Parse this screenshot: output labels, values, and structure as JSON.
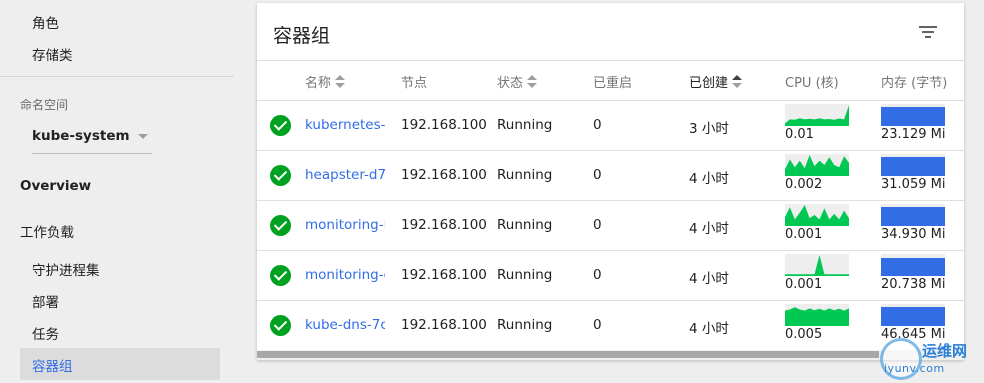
{
  "sidebar": {
    "items_top": [
      "角色",
      "存储类"
    ],
    "namespace_label": "命名空间",
    "namespace_value": "kube-system",
    "overview": "Overview",
    "workloads": "工作负载",
    "workload_items": [
      "守护进程集",
      "部署",
      "任务"
    ],
    "active_item": "容器组"
  },
  "card": {
    "title": "容器组",
    "filter_icon": "filter-list-icon",
    "columns": [
      "名称",
      "节点",
      "状态",
      "已重启",
      "已创建",
      "CPU (核)",
      "内存 (字节)"
    ],
    "sorted_column": "已创建",
    "status_icon": "check-circle-icon",
    "status_color": "#00a020",
    "rows": [
      {
        "name": "kubernetes-c",
        "node": "192.168.100",
        "status": "Running",
        "restarts": "0",
        "created": "3 小时",
        "cpu": "0.01",
        "memory": "23.129 Mi",
        "cpu_trend": [
          0.12,
          0.3,
          0.28,
          0.35,
          0.3,
          0.33,
          0.3,
          0.35,
          0.3,
          0.32,
          0.28,
          0.34,
          0.3,
          0.95
        ]
      },
      {
        "name": "heapster-d7",
        "node": "192.168.100",
        "status": "Running",
        "restarts": "0",
        "created": "4 小时",
        "cpu": "0.002",
        "memory": "31.059 Mi",
        "cpu_trend": [
          0.3,
          0.75,
          0.4,
          0.7,
          0.35,
          0.95,
          0.45,
          0.7,
          0.5,
          0.85,
          0.5,
          0.4,
          0.9,
          0.6
        ]
      },
      {
        "name": "monitoring-ir",
        "node": "192.168.100",
        "status": "Running",
        "restarts": "0",
        "created": "4 小时",
        "cpu": "0.001",
        "memory": "34.930 Mi",
        "cpu_trend": [
          0.4,
          0.85,
          0.3,
          0.6,
          0.95,
          0.35,
          0.5,
          0.3,
          0.8,
          0.3,
          0.55,
          0.3,
          0.7,
          0.35
        ]
      },
      {
        "name": "monitoring-g",
        "node": "192.168.100",
        "status": "Running",
        "restarts": "0",
        "created": "4 小时",
        "cpu": "0.001",
        "memory": "20.738 Mi",
        "cpu_trend": [
          0.08,
          0.08,
          0.08,
          0.08,
          0.08,
          0.08,
          0.08,
          0.95,
          0.08,
          0.08,
          0.08,
          0.08,
          0.08,
          0.08
        ]
      },
      {
        "name": "kube-dns-7c",
        "node": "192.168.100",
        "status": "Running",
        "restarts": "0",
        "created": "4 小时",
        "cpu": "0.005",
        "memory": "46.645 Mi",
        "cpu_trend": [
          0.7,
          0.75,
          0.85,
          0.75,
          0.7,
          0.8,
          0.72,
          0.78,
          0.7,
          0.8,
          0.72,
          0.78,
          0.7,
          0.8
        ]
      }
    ],
    "memory_level": [
      0.85,
      0.85,
      0.85,
      0.8,
      0.85
    ]
  },
  "colors": {
    "link": "#326de6",
    "cpu_green": "#00c853",
    "mem_blue": "#326de6"
  },
  "watermark": {
    "top": "运维网",
    "bottom": "iyunv.com"
  }
}
